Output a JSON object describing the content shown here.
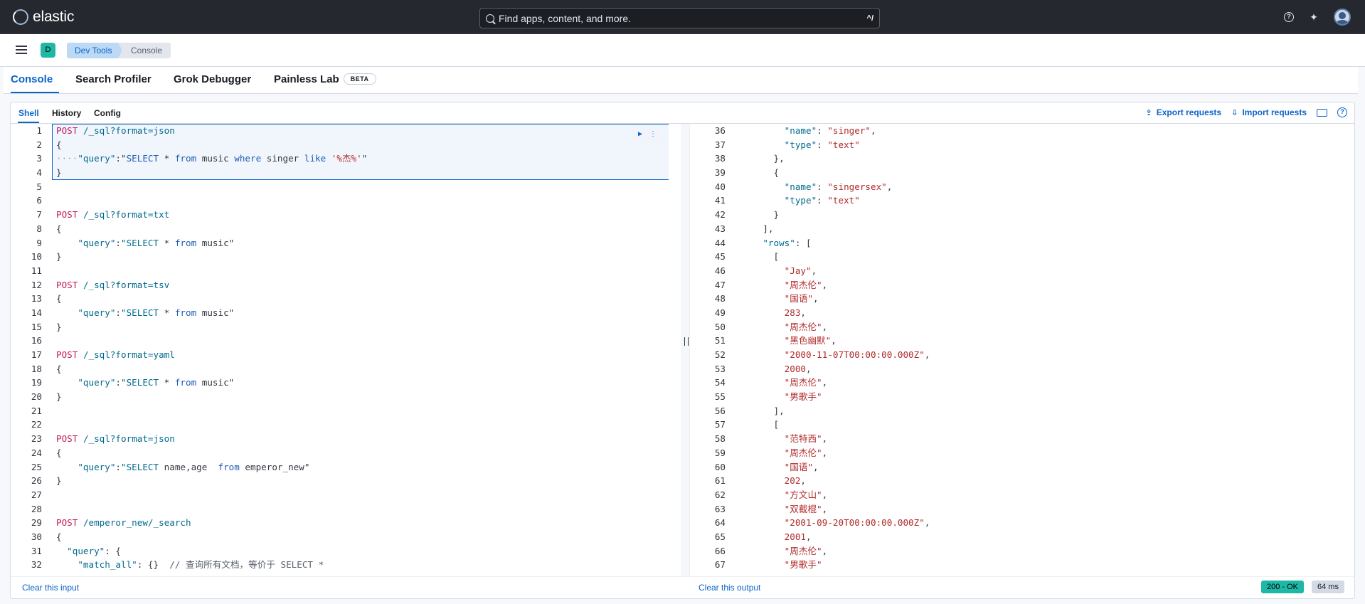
{
  "header": {
    "brand": "elastic",
    "search_placeholder": "Find apps, content, and more.",
    "search_shortcut": "^/",
    "help_icon": "help-icon",
    "news_icon": "newsfeed-icon",
    "avatar_icon": "user-avatar"
  },
  "breadcrumbs": {
    "space_initial": "D",
    "items": [
      "Dev Tools",
      "Console"
    ]
  },
  "tabs": [
    {
      "label": "Console",
      "active": true
    },
    {
      "label": "Search Profiler"
    },
    {
      "label": "Grok Debugger"
    },
    {
      "label": "Painless Lab",
      "badge": "BETA"
    }
  ],
  "subtabs": [
    {
      "label": "Shell",
      "active": true
    },
    {
      "label": "History"
    },
    {
      "label": "Config"
    }
  ],
  "actions": {
    "export": "Export requests",
    "import": "Import requests"
  },
  "input_lines": {
    "numbers": [
      "1",
      "2",
      "3",
      "4",
      "5",
      "6",
      "7",
      "8",
      "9",
      "10",
      "11",
      "12",
      "13",
      "14",
      "15",
      "16",
      "17",
      "18",
      "19",
      "20",
      "21",
      "22",
      "23",
      "24",
      "25",
      "26",
      "27",
      "28",
      "29",
      "30",
      "31",
      "32"
    ]
  },
  "input": {
    "l1_method": "POST",
    "l1_url": "/_sql?format=json",
    "l3_key": "\"query\"",
    "l3_sel": "SELECT",
    "l3_mid": " * ",
    "l3_from": "from",
    "l3_tbl": " music ",
    "l3_where": "where",
    "l3_col": " singer ",
    "l3_like": "like",
    "l3_pat": "'%杰%'",
    "l7_method": "POST",
    "l7_url": "/_sql?format=txt",
    "l9_key": "\"query\"",
    "l9_sel": "\"SELECT",
    "l9_star": " * ",
    "l9_from": "from",
    "l9_tbl": " music\"",
    "l12_method": "POST",
    "l12_url": "/_sql?format=tsv",
    "l14_key": "\"query\"",
    "l14_sel": "\"SELECT",
    "l14_star": " * ",
    "l14_from": "from",
    "l14_tbl": " music\"",
    "l17_method": "POST",
    "l17_url": "/_sql?format=yaml",
    "l19_key": "\"query\"",
    "l19_sel": "\"SELECT",
    "l19_star": " * ",
    "l19_from": "from",
    "l19_tbl": " music\"",
    "l23_method": "POST",
    "l23_url": "/_sql?format=json",
    "l25_key": "\"query\"",
    "l25_sel": "\"SELECT",
    "l25_cols": " name,age  ",
    "l25_from": "from",
    "l25_tbl": " emperor_new\"",
    "l29_method": "POST",
    "l29_url": "/emperor_new/_search",
    "l31_key": "\"query\"",
    "l31_rest": ": {",
    "l32_key": "\"match_all\"",
    "l32_rest": ": {}  ",
    "l32_comment": "// 查询所有文档，等价于 SELECT *"
  },
  "output_lines": {
    "numbers": [
      "36",
      "37",
      "38",
      "39",
      "40",
      "41",
      "42",
      "43",
      "44",
      "45",
      "46",
      "47",
      "48",
      "49",
      "50",
      "51",
      "52",
      "53",
      "54",
      "55",
      "56",
      "57",
      "58",
      "59",
      "60",
      "61",
      "62",
      "63",
      "64",
      "65",
      "66",
      "67"
    ]
  },
  "output": {
    "o36_key": "\"name\"",
    "o36_val": "\"singer\"",
    "o37_key": "\"type\"",
    "o37_val": "\"text\"",
    "o40_key": "\"name\"",
    "o40_val": "\"singersex\"",
    "o41_key": "\"type\"",
    "o41_val": "\"text\"",
    "o44_key": "\"rows\"",
    "r1": [
      "\"Jay\"",
      "\"周杰伦\"",
      "\"国语\"",
      "283",
      "\"周杰伦\"",
      "\"黑色幽默\"",
      "\"2000-11-07T00:00:00.000Z\"",
      "2000",
      "\"周杰伦\"",
      "\"男歌手\""
    ],
    "r2": [
      "\"范特西\"",
      "\"周杰伦\"",
      "\"国语\"",
      "202",
      "\"方文山\"",
      "\"双截棍\"",
      "\"2001-09-20T00:00:00.000Z\"",
      "2001",
      "\"周杰伦\"",
      "\"男歌手\""
    ]
  },
  "footer": {
    "clear_input": "Clear this input",
    "clear_output": "Clear this output",
    "status": "200 - OK",
    "time": "64 ms"
  },
  "colors": {
    "accent": "#0b64c8",
    "success": "#1fb8a7",
    "header_bg": "#25282f"
  }
}
